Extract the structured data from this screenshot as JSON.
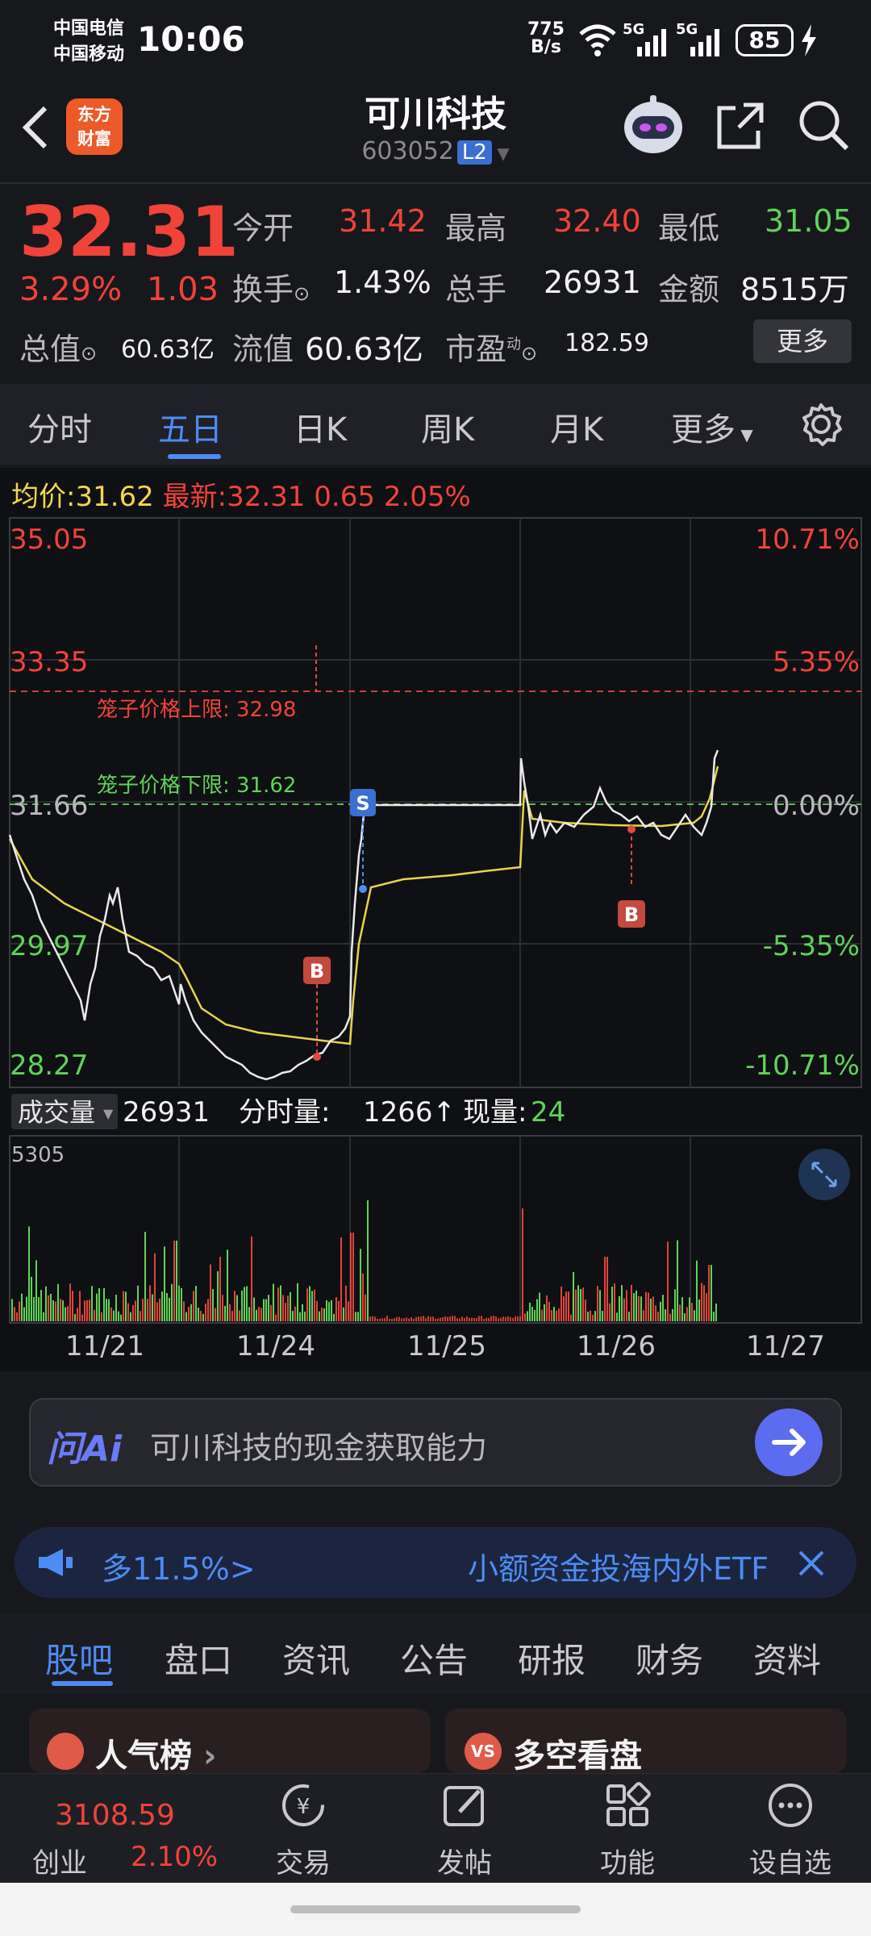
{
  "status_bar": {
    "carrier1": "中国电信",
    "carrier2": "中国移动",
    "time": "10:06",
    "net_speed": "775",
    "net_unit": "B/s",
    "battery": "85"
  },
  "header": {
    "logo_line1": "东方",
    "logo_line2": "财富",
    "title": "可川科技",
    "code": "603052",
    "level": "L2"
  },
  "quote": {
    "price": "32.31",
    "change_pct": "3.29%",
    "change": "1.03",
    "open_label": "今开",
    "open": "31.42",
    "high_label": "最高",
    "high": "32.40",
    "low_label": "最低",
    "low": "31.05",
    "turnover_label": "换手",
    "turnover": "1.43%",
    "volume_label": "总手",
    "volume": "26931",
    "amount_label": "金额",
    "amount": "8515万",
    "mktcap_label": "总值",
    "mktcap": "60.63亿",
    "float_label": "流值",
    "float": "60.63亿",
    "pe_label": "市盈",
    "pe_sup": "动",
    "pe": "182.59",
    "more": "更多"
  },
  "period_tabs": [
    "分时",
    "五日",
    "日K",
    "周K",
    "月K",
    "更多"
  ],
  "chart": {
    "avg_label": "均价:",
    "avg": "31.62",
    "last_label": "最新:",
    "last": "32.31",
    "last_chg": "0.65",
    "last_pct": "2.05%",
    "y_left": [
      "35.05",
      "33.35",
      "31.66",
      "29.97",
      "28.27"
    ],
    "y_right": [
      "10.71%",
      "5.35%",
      "0.00%",
      "-5.35%",
      "-10.71%"
    ],
    "upper_limit": "笼子价格上限: 32.98",
    "lower_limit": "笼子价格下限: 31.62",
    "marker_s": "S",
    "marker_b": "B",
    "vol_label": "成交量",
    "vol_value": "26931",
    "vol_tick_label": "分时量:",
    "vol_tick": "1266↑",
    "vol_now_label": "现量:",
    "vol_now": "24",
    "vol_max": "5305",
    "dates": [
      "11/21",
      "11/24",
      "11/25",
      "11/26",
      "11/27"
    ]
  },
  "ai": {
    "badge": "问Ai",
    "text": "可川科技的现金获取能力"
  },
  "ticker": {
    "left_text": "多11.5%>",
    "right_text": "小额资金投海内外ETF"
  },
  "bottom_tabs": [
    "股吧",
    "盘口",
    "资讯",
    "公告",
    "研报",
    "财务",
    "资料"
  ],
  "cards": {
    "left": "人气榜",
    "right_badge": "VS",
    "right": "多空看盘"
  },
  "nav": {
    "index_value": "3108.59",
    "index_name": "创业",
    "index_pct": "2.10%",
    "trade": "交易",
    "post": "发帖",
    "func": "功能",
    "watch": "设自选"
  }
}
